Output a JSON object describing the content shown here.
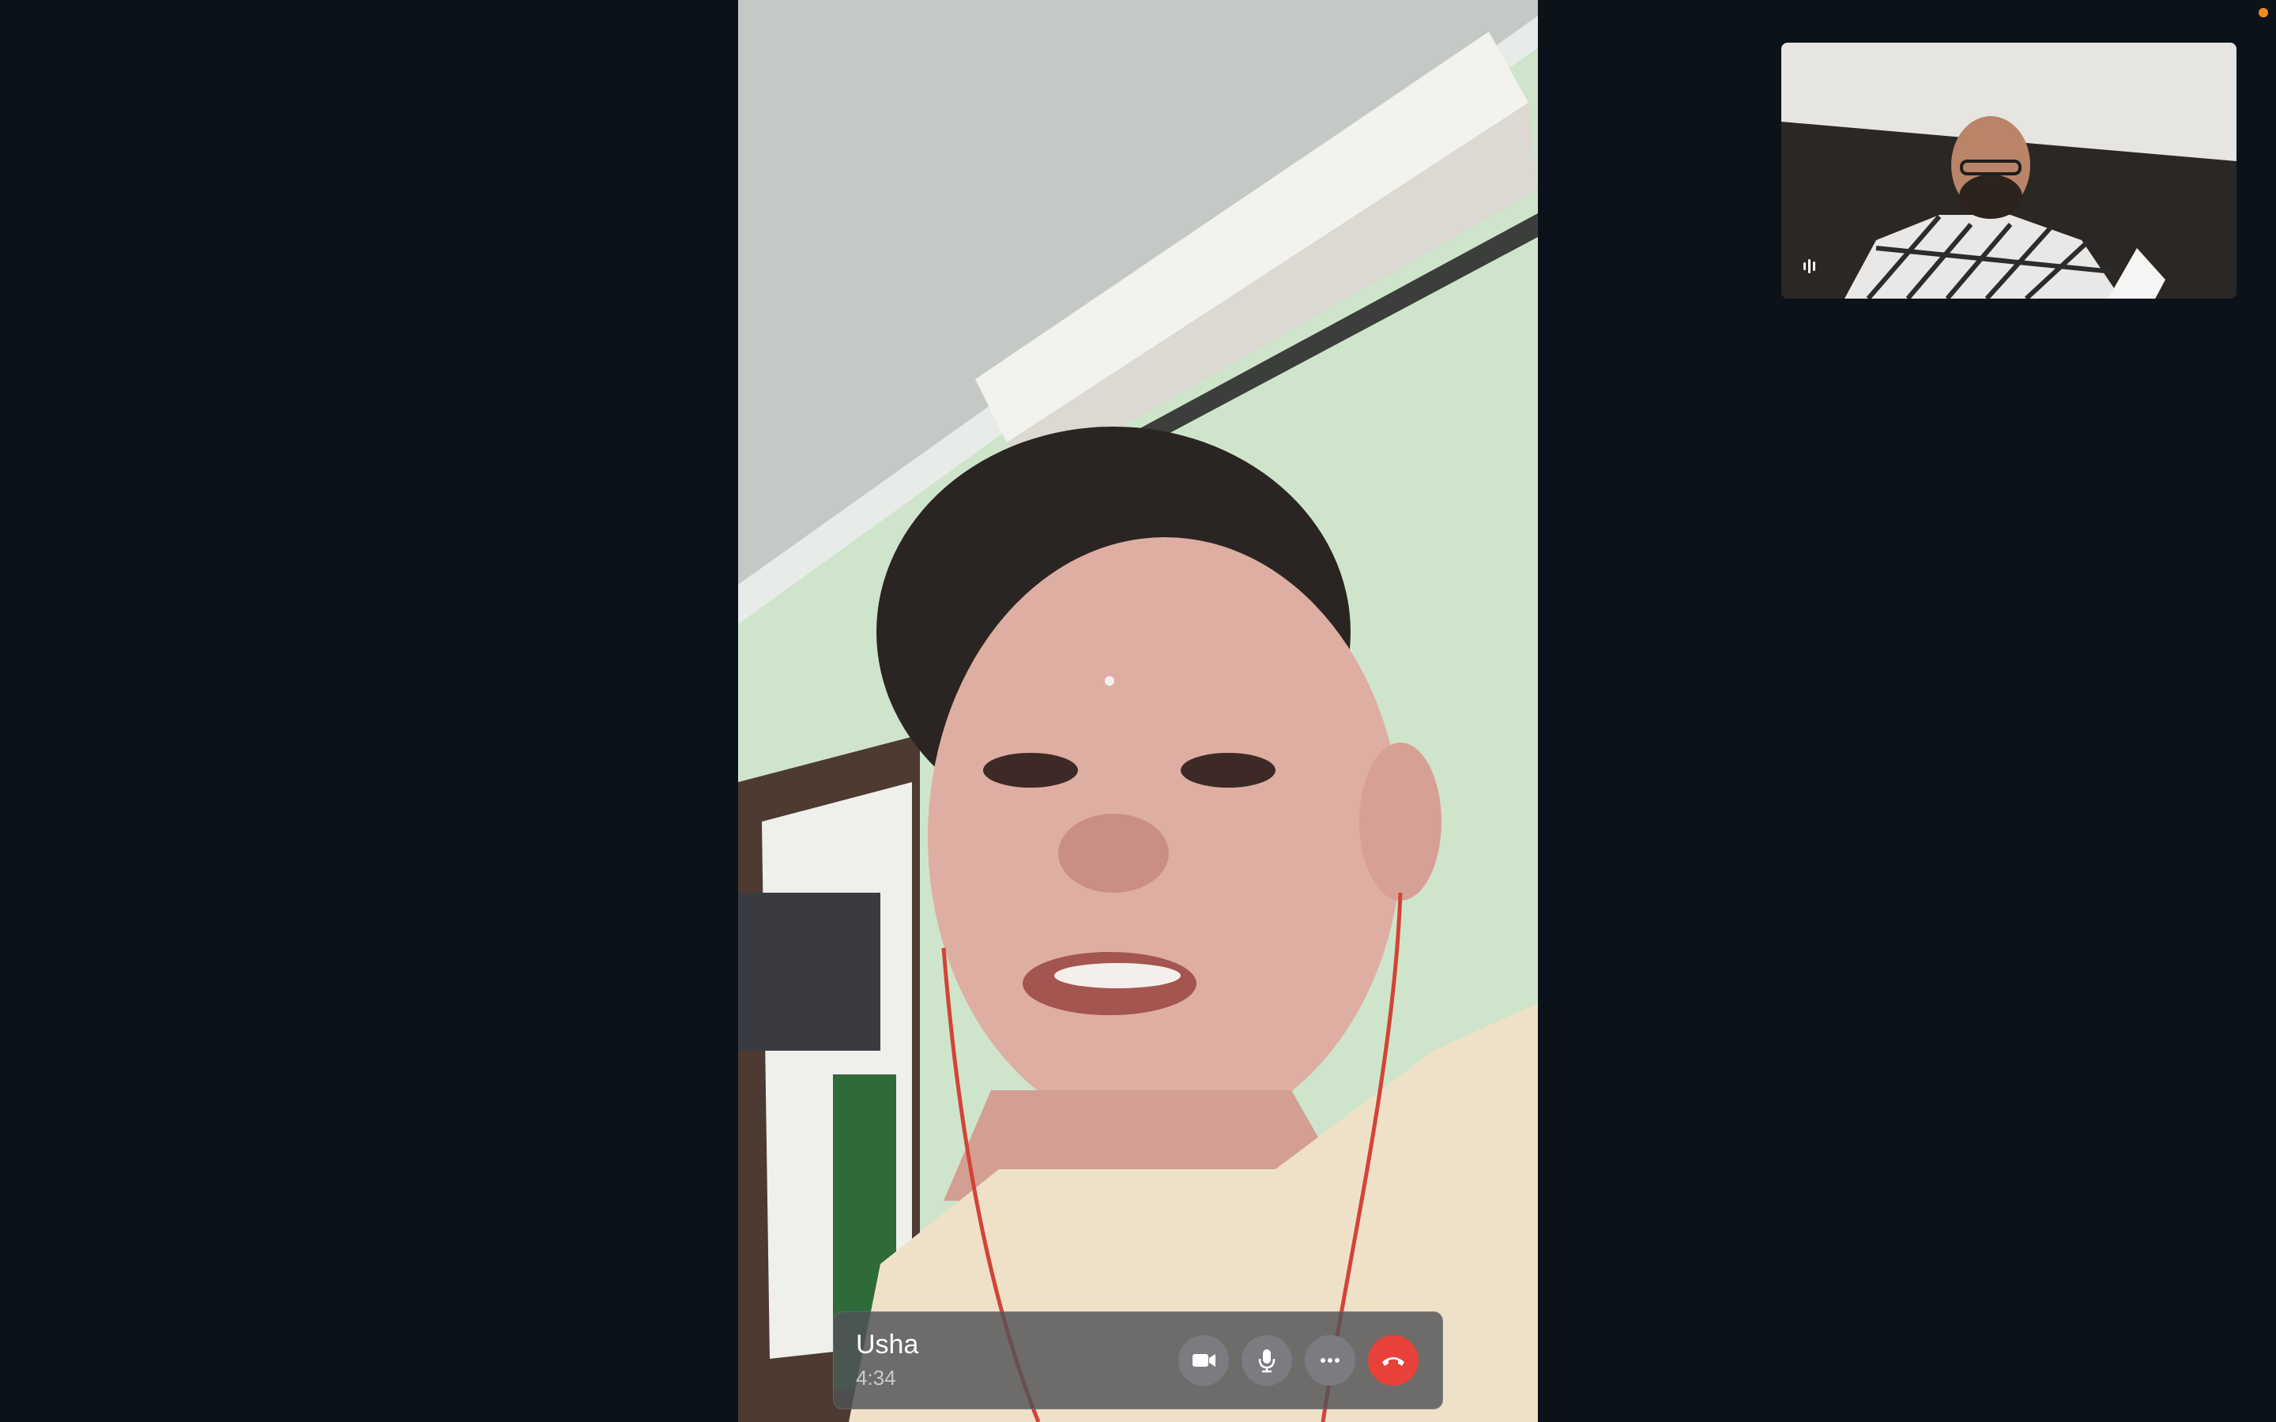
{
  "call": {
    "caller_name": "Usha",
    "duration": "4:34"
  },
  "controls": {
    "camera_icon": "video-camera-icon",
    "mic_icon": "microphone-icon",
    "more_icon": "ellipsis-icon",
    "end_icon": "phone-hangup-icon"
  },
  "self_view": {
    "indicator_icon": "audio-level-icon"
  },
  "colors": {
    "background": "#0b121a",
    "end_call": "#e8413a",
    "control_button": "#7a7c80",
    "recording_dot": "#f2891c"
  }
}
